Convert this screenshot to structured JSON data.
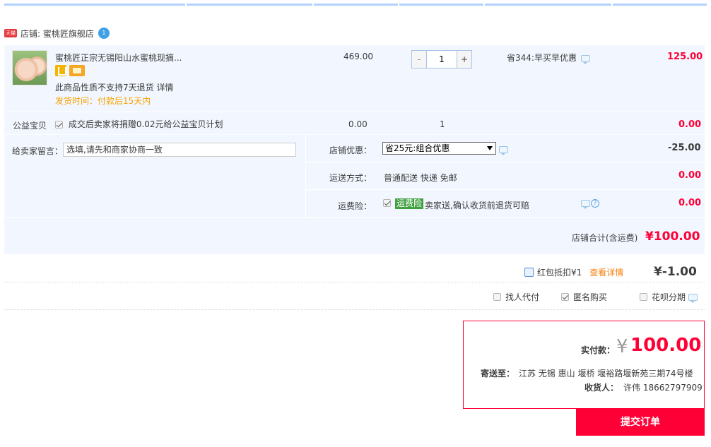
{
  "shop": {
    "badge": "天猫",
    "label": "店铺: 蜜桃匠旗舰店",
    "ww_badge": "1"
  },
  "item": {
    "title": "蜜桃匠正宗无锡阳山水蜜桃现摘...",
    "no_return": "此商品性质不支持7天退货 详情",
    "ship_time": "发货时间：付款后15天内",
    "unit_price": "469.00",
    "qty_minus": "-",
    "qty": "1",
    "qty_plus": "+",
    "promo": "省344:早买早优惠",
    "subtotal": "125.00"
  },
  "charity": {
    "label": "公益宝贝",
    "text": "成交后卖家将捐赠0.02元给公益宝贝计划",
    "price": "0.00",
    "qty": "1",
    "total": "0.00"
  },
  "message": {
    "label": "给卖家留言：",
    "placeholder": "选填,请先和商家协商一致"
  },
  "store_discount": {
    "label": "店铺优惠：",
    "selected": "省25元:组合优惠",
    "value": "-25.00"
  },
  "shipping": {
    "label": "运送方式：",
    "value": "普通配送 快递 免邮",
    "total": "0.00"
  },
  "insurance": {
    "label": "运费险：",
    "badge": "运费险",
    "text": "卖家送,确认收货前退货可赔",
    "total": "0.00"
  },
  "store_sum": {
    "label": "店铺合计(含运费)",
    "value": "¥100.00"
  },
  "red_packet": {
    "text": "红包抵扣¥1",
    "link": "查看详情",
    "value": "¥-1.00"
  },
  "options": [
    {
      "label": "找人代付",
      "checked": false
    },
    {
      "label": "匿名购买",
      "checked": true
    },
    {
      "label": "花呗分期",
      "checked": false
    }
  ],
  "payment": {
    "label": "实付款：",
    "currency": "¥",
    "amount": "100.00",
    "addr_label": "寄送至：",
    "address": "江苏 无锡 惠山 堰桥 堰裕路堰新苑三期74号楼",
    "recv_label": "收货人：",
    "receiver": "许伟 18662797909"
  },
  "submit_label": "提交订单",
  "colors": {
    "accent": "#ff0036",
    "panel": "#f2f7ff",
    "border": "#b2d1ff"
  }
}
